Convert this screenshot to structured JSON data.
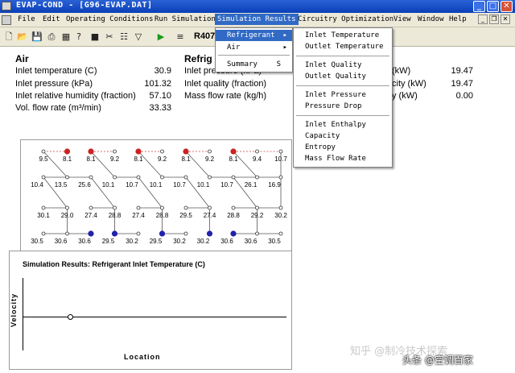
{
  "window": {
    "title": "EVAP-COND - [G96-EVAP.DAT]",
    "min_glyph": "_",
    "max_glyph": "□",
    "close_glyph": "✕"
  },
  "menubar": {
    "items": [
      "File",
      "Edit",
      "Operating Conditions",
      "Run Simulation",
      "Simulation Results",
      "Circuitry Optimization",
      "View",
      "Window",
      "Help"
    ],
    "active": "Simulation Results"
  },
  "toolbar": {
    "label": "R407"
  },
  "air": {
    "title": "Air",
    "rows": [
      {
        "label": "Inlet temperature (C)",
        "value": "30.9"
      },
      {
        "label": "Inlet pressure (kPa)",
        "value": "101.32"
      },
      {
        "label": "Inlet relative humidity (fraction)",
        "value": "57.10"
      },
      {
        "label": "Vol. flow rate (m³/min)",
        "value": "33.33"
      }
    ]
  },
  "refrigerant": {
    "title": "Refrig",
    "rows": [
      {
        "label": "Inlet pressure (kPa)",
        "value": ""
      },
      {
        "label": "Inlet quality (fraction)",
        "value": ""
      },
      {
        "label": "Mass flow rate (kg/h)",
        "value": ""
      }
    ],
    "right_rows": [
      {
        "label": "(kW)",
        "value": "19.47"
      },
      {
        "label": "city (kW)",
        "value": "19.47"
      },
      {
        "label": "y (kW)",
        "value": "0.00"
      }
    ]
  },
  "results_menu": {
    "items": [
      {
        "label": "Refrigerant",
        "has_submenu": true,
        "highlighted": true
      },
      {
        "label": "Air",
        "has_submenu": true,
        "highlighted": false
      },
      {
        "label": "Summary",
        "shortcut": "S",
        "highlighted": false
      }
    ]
  },
  "refrigerant_submenu": {
    "groups": [
      [
        "Inlet Temperature",
        "Outlet Temperature"
      ],
      [
        "Inlet Quality",
        "Outlet Quality"
      ],
      [
        "Inlet Pressure",
        "Pressure Drop"
      ],
      [
        "Inlet Enthalpy",
        "Capacity",
        "Entropy",
        "Mass Flow Rate"
      ]
    ]
  },
  "circuit": {
    "rows": [
      [
        "9.5",
        "8.1",
        "8.1",
        "9.2",
        "8.1",
        "9.2",
        "8.1",
        "9.2",
        "8.1",
        "9.4",
        "10.7"
      ],
      [
        "10.4",
        "13.5",
        "25.6",
        "10.1",
        "10.7",
        "10.1",
        "10.7",
        "10.1",
        "10.7",
        "26.1",
        "16.9"
      ],
      [
        "30.1",
        "29.0",
        "27.4",
        "28.8",
        "27.4",
        "28.8",
        "29.5",
        "27.4",
        "28.8",
        "29.2",
        "30.2"
      ],
      [
        "30.5",
        "30.6",
        "30.6",
        "29.5",
        "30.2",
        "29.5",
        "30.2",
        "30.2",
        "30.6",
        "30.6",
        "30.5"
      ]
    ],
    "colors": {
      "inlet": "#cc2222",
      "outlet": "#2222aa",
      "link": "#555555"
    }
  },
  "chart": {
    "title": "Simulation Results: Refrigerant Inlet Temperature (C)",
    "ylabel": "Velocity",
    "xlabel": "Location"
  },
  "watermark": {
    "text1": "知乎 @制冷技术探索",
    "text2": "头条 @空调百家"
  }
}
